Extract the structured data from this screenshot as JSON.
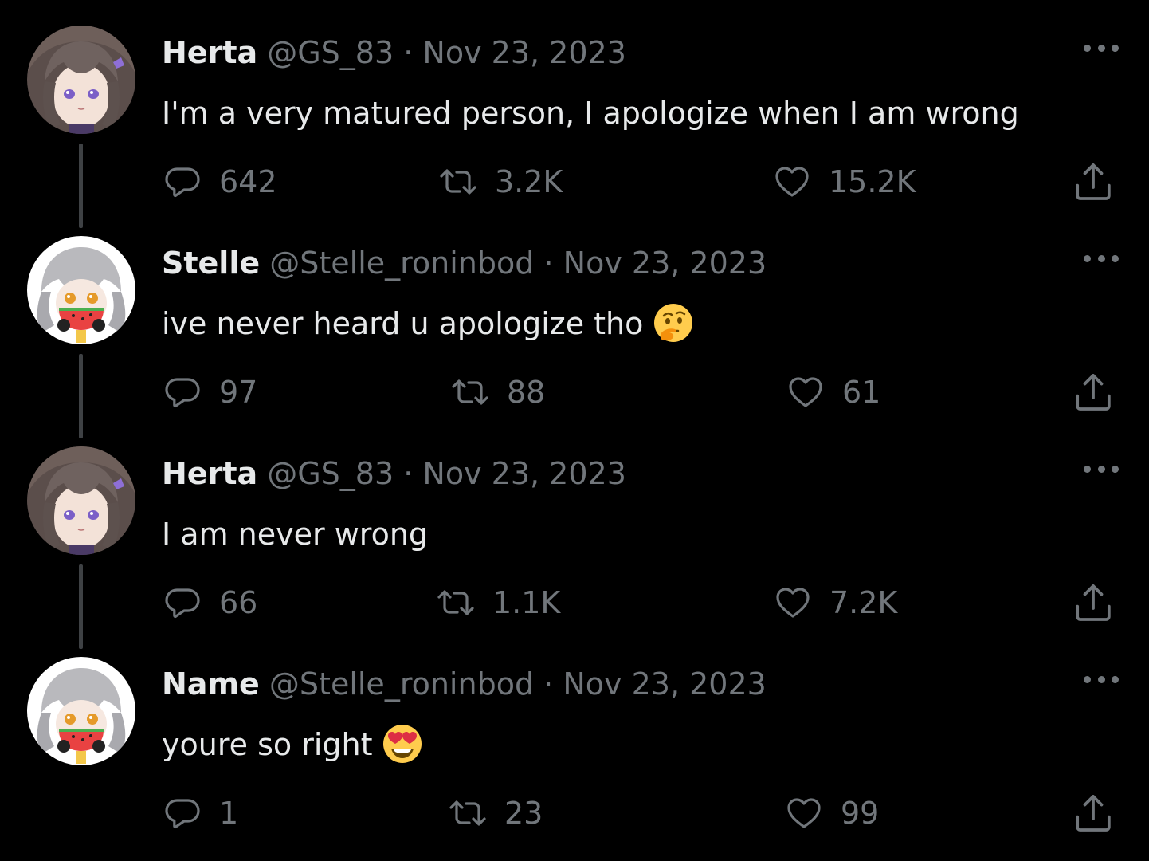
{
  "colors": {
    "background": "#000000",
    "text_primary": "#e7e9ea",
    "text_secondary": "#71767b",
    "thread_line": "#3e4144"
  },
  "icons": {
    "reply": "reply-bubble-icon",
    "retweet": "retweet-arrows-icon",
    "like": "heart-icon",
    "share": "share-upload-icon",
    "more": "more-dots-icon"
  },
  "tweets": [
    {
      "name": "Herta",
      "handle": "@GS_83",
      "separator": "·",
      "date": "Nov 23, 2023",
      "text": "I'm a very matured person, I apologize when I am wrong",
      "emoji": "",
      "avatar": "herta-avatar",
      "replies": "642",
      "retweets": "3.2K",
      "likes": "15.2K"
    },
    {
      "name": "Stelle",
      "handle": "@Stelle_roninbod",
      "separator": "·",
      "date": "Nov 23, 2023",
      "text": "ive never heard u apologize tho",
      "emoji": "thinking-face-emoji",
      "avatar": "stelle-avatar",
      "replies": "97",
      "retweets": "88",
      "likes": "61"
    },
    {
      "name": "Herta",
      "handle": "@GS_83",
      "separator": "·",
      "date": "Nov 23, 2023",
      "text": "I am never wrong",
      "emoji": "",
      "avatar": "herta-avatar",
      "replies": "66",
      "retweets": "1.1K",
      "likes": "7.2K"
    },
    {
      "name": "Name",
      "handle": "@Stelle_roninbod",
      "separator": "·",
      "date": "Nov 23, 2023",
      "text": "youre so right",
      "emoji": "heart-eyes-emoji",
      "avatar": "stelle-avatar",
      "replies": "1",
      "retweets": "23",
      "likes": "99"
    }
  ]
}
